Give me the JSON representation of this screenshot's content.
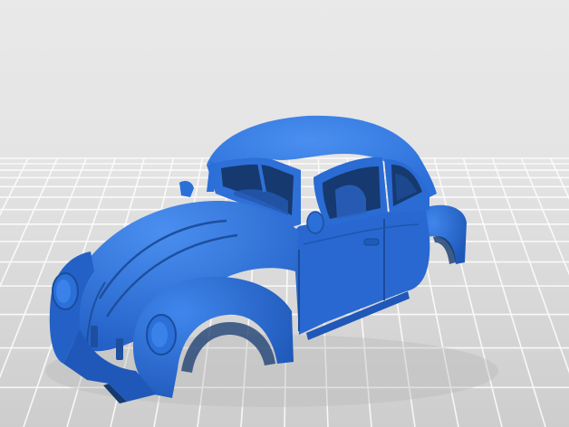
{
  "scene": {
    "subject": "car-body-shell-model",
    "colors": {
      "background_top": "#e9e9e9",
      "background_bottom": "#cdcdcd",
      "grid_line": "#ffffff",
      "model_base": "#2b6fd8",
      "model_highlight": "#4a8ff0",
      "model_shadow": "#1d4f9e",
      "interior_dark": "#16396f"
    }
  }
}
